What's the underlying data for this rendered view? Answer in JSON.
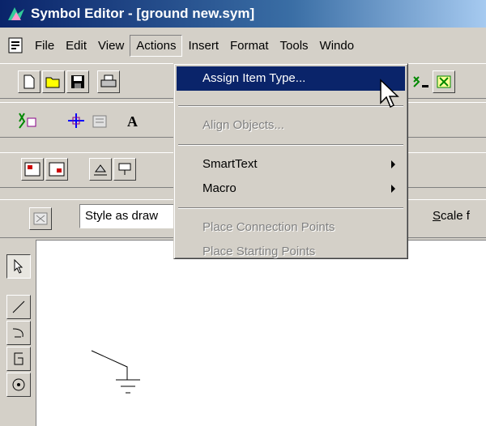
{
  "window": {
    "title": "Symbol Editor - [ground new.sym]"
  },
  "menubar": {
    "items": [
      "File",
      "Edit",
      "View",
      "Actions",
      "Insert",
      "Format",
      "Tools",
      "Windo"
    ],
    "active": "Actions"
  },
  "actions_menu": {
    "assign_item_type": "Assign Item Type...",
    "align_objects": "Align Objects...",
    "smart_text": "SmartText",
    "macro": "Macro",
    "place_connection_points": "Place Connection Points",
    "place_starting_points": "Place Starting Points"
  },
  "format_bar": {
    "style_value": "Style as draw",
    "scale_label_u": "S",
    "scale_label_rest": "cale f"
  },
  "colors": {
    "title_active": "#0a246a",
    "highlight": "#0a246a",
    "face": "#d4d0c8"
  },
  "icons": [
    "new-file-icon",
    "open-folder-icon",
    "save-icon",
    "print-icon",
    "text-tool-icon",
    "pointer-icon",
    "line-icon",
    "arc-icon",
    "polyline-icon",
    "circle-icon",
    "ground-symbol"
  ]
}
